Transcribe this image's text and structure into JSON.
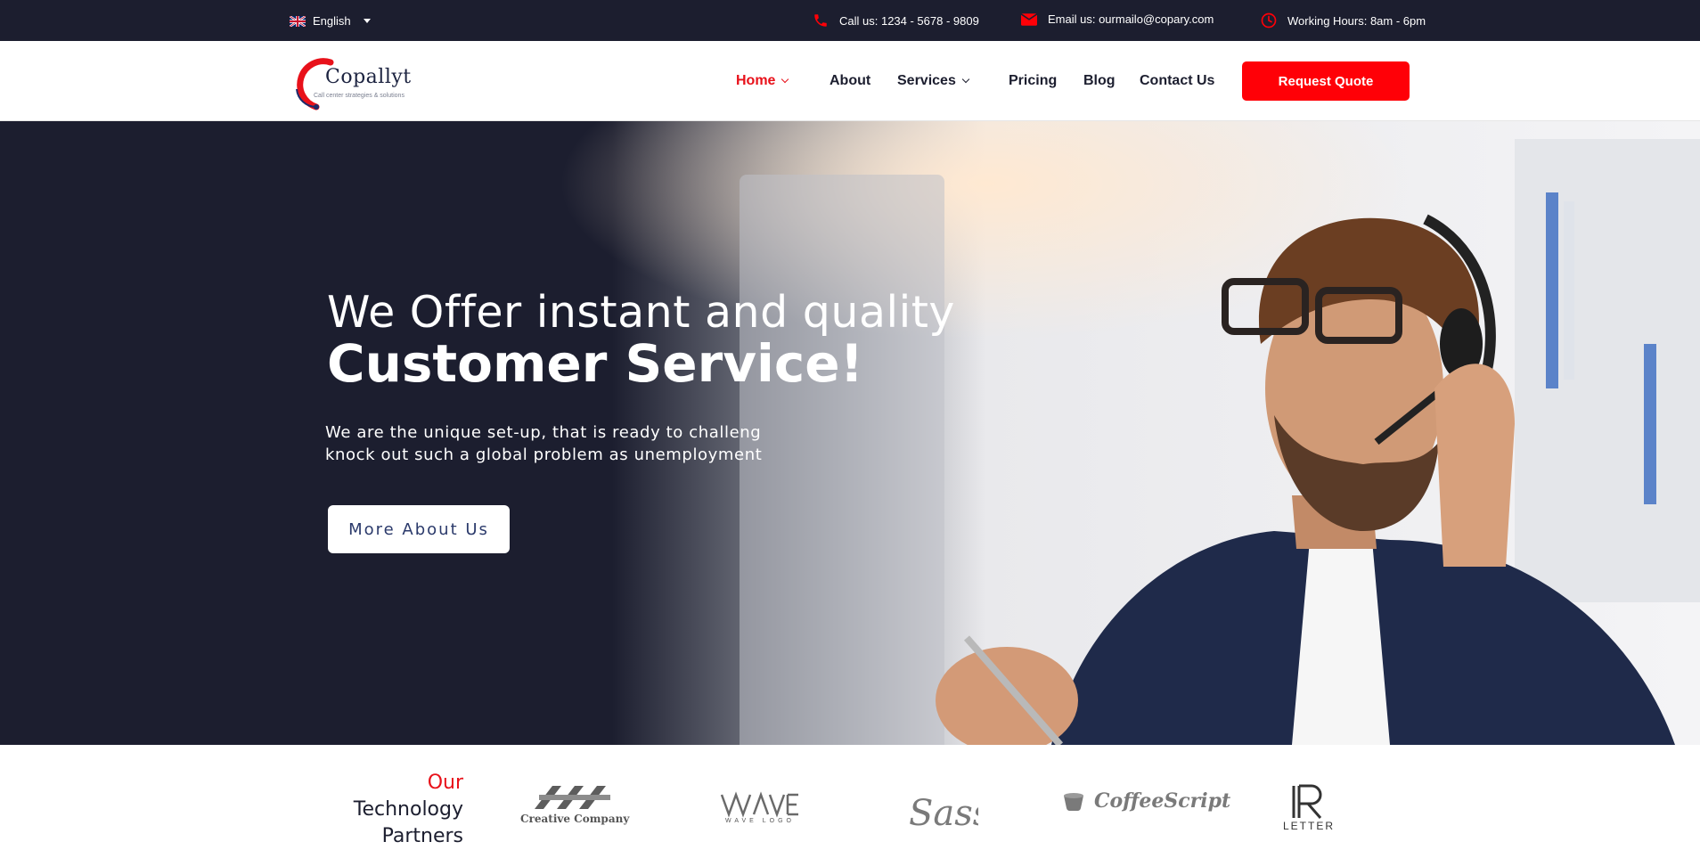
{
  "topbar": {
    "language": "English",
    "phone": "Call us: 1234 - 5678 - 9809",
    "email": "Email us: ourmailo@copary.com",
    "hours": "Working Hours: 8am - 6pm",
    "icons": [
      "uk-flag-icon",
      "phone-icon",
      "envelope-icon",
      "clock-icon"
    ]
  },
  "brand": {
    "name": "Copallyt",
    "tagline": "Call center strategies & solutions"
  },
  "nav": {
    "items": [
      {
        "label": "Home",
        "active": true,
        "dropdown": true
      },
      {
        "label": "About",
        "active": false,
        "dropdown": false
      },
      {
        "label": "Services",
        "active": false,
        "dropdown": true
      },
      {
        "label": "Pricing",
        "active": false,
        "dropdown": false
      },
      {
        "label": "Blog",
        "active": false,
        "dropdown": false
      },
      {
        "label": "Contact Us",
        "active": false,
        "dropdown": false
      }
    ],
    "cta": "Request Quote"
  },
  "hero": {
    "heading_light": "We Offer instant and quality",
    "heading_bold": "Customer Service!",
    "sub_line1": "We are the unique set-up, that is ready to challeng",
    "sub_line2": "knock out such a global problem as unemployment",
    "button": "More About Us"
  },
  "partners": {
    "title_line1": "Our",
    "title_line2": "Technology",
    "title_line3": "Partners",
    "logos": [
      {
        "caption": "Creative Company",
        "icon": "creative-company-logo"
      },
      {
        "caption": "WAVE LOGO",
        "icon": "wave-logo"
      },
      {
        "caption": "Sass",
        "icon": "sass-logo"
      },
      {
        "caption": "CoffeeScript",
        "icon": "coffeescript-logo"
      },
      {
        "caption": "LETTER",
        "icon": "letter-logo"
      }
    ]
  },
  "colors": {
    "dark": "#1c1e2f",
    "accent": "#ff0007",
    "white": "#ffffff"
  }
}
